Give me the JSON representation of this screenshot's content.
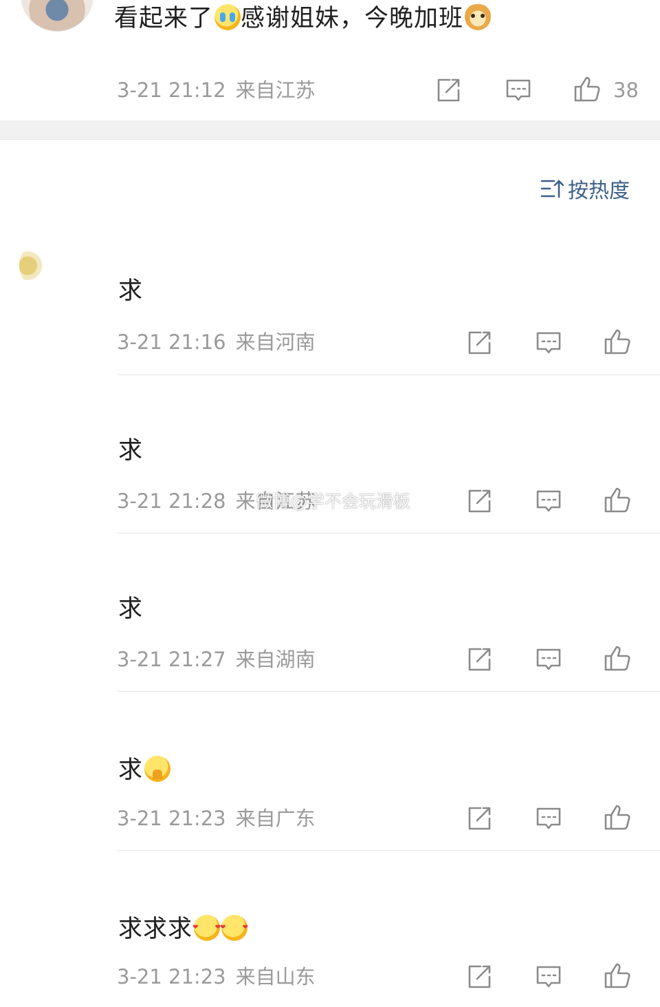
{
  "top_comment": {
    "text_part1": "看起来了",
    "text_part2": "感谢姐妹，今晚加班",
    "emoji1": "crying-face",
    "emoji2": "doge-face",
    "time": "3-21 21:12",
    "location": "来自江苏",
    "like_count": "38"
  },
  "sort_label": "按热度",
  "replies": [
    {
      "text": "求",
      "emojis": [],
      "time": "3-21 21:16",
      "location": "来自河南"
    },
    {
      "text": "求",
      "emojis": [],
      "time": "3-21 21:28",
      "location": "来自江苏"
    },
    {
      "text": "求",
      "emojis": [],
      "time": "3-21 21:27",
      "location": "来自湖南"
    },
    {
      "text": "求",
      "emojis": [
        "praying-face"
      ],
      "time": "3-21 21:23",
      "location": "来自广东"
    },
    {
      "text": "求求求",
      "emojis": [
        "love-face",
        "love-face"
      ],
      "time": "3-21 21:23",
      "location": "来自山东"
    }
  ],
  "watermark": "微博@学不会玩滑板",
  "icons": {
    "share": "share-icon",
    "comment": "comment-icon",
    "like": "like-icon",
    "sort": "sort-icon"
  },
  "colors": {
    "meta_gray": "#9a9a9a",
    "sort_blue": "#3d5f8a",
    "section_gap": "#f1f1f1"
  }
}
